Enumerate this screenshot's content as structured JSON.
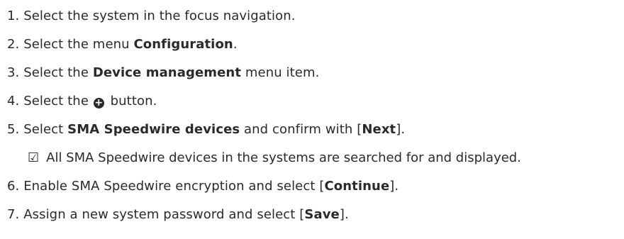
{
  "steps": [
    {
      "num": "1.",
      "pre": " Select the system in the focus navigation."
    },
    {
      "num": "2.",
      "pre": " Select the menu ",
      "bold": "Configuration",
      "post": "."
    },
    {
      "num": "3.",
      "pre": " Select the ",
      "bold": "Device management",
      "post": " menu item."
    },
    {
      "num": "4.",
      "pre": " Select the ",
      "post": " button."
    },
    {
      "num": "5.",
      "pre": " Select ",
      "bold": "SMA Speedwire devices",
      "mid": " and confirm with [",
      "bold2": "Next",
      "post": "]."
    },
    {
      "num": "6.",
      "pre": " Enable SMA Speedwire encryption and select [",
      "bold": "Continue",
      "post": "]."
    },
    {
      "num": "7.",
      "pre": " Assign a new system password and select [",
      "bold": "Save",
      "post": "]."
    }
  ],
  "result": {
    "icon": "checkbox-checked-icon",
    "glyph": "☑",
    "text": "All SMA Speedwire devices in the systems are searched for and displayed."
  },
  "icons": {
    "plus": "+"
  }
}
